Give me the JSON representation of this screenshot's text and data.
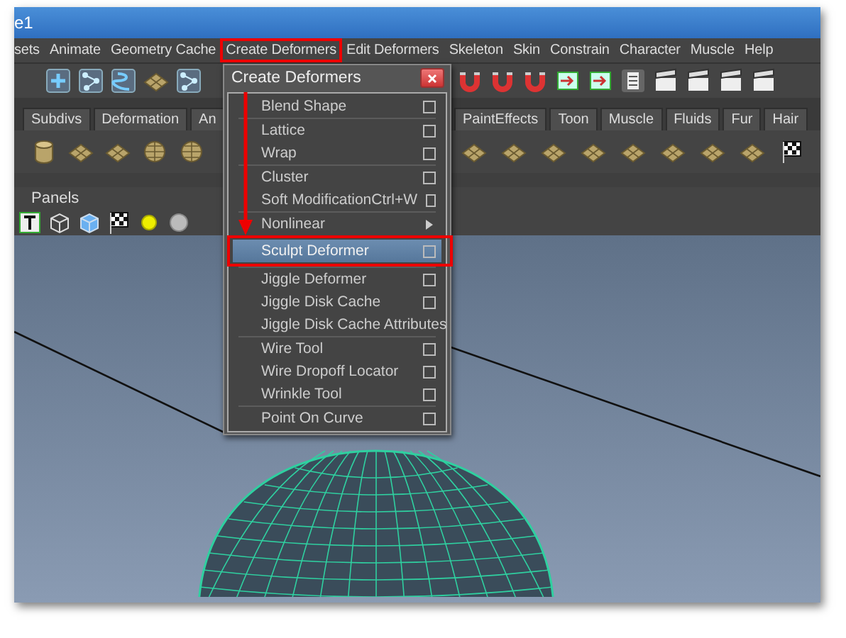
{
  "window": {
    "title": "e1"
  },
  "menu_bar": [
    "sets",
    "Animate",
    "Geometry Cache",
    "Create Deformers",
    "Edit Deformers",
    "Skeleton",
    "Skin",
    "Constrain",
    "Character",
    "Muscle",
    "Help"
  ],
  "shelf_tabs_left": [
    "Subdivs",
    "Deformation",
    "An"
  ],
  "shelf_tabs_right": [
    "PaintEffects",
    "Toon",
    "Muscle",
    "Fluids",
    "Fur",
    "Hair"
  ],
  "panel_menu": [
    "Panels"
  ],
  "popup": {
    "title": "Create Deformers",
    "groups": [
      [
        {
          "label": "Blend Shape",
          "option_box": true,
          "submenu": false,
          "selected": false
        }
      ],
      [
        {
          "label": "Lattice",
          "option_box": true,
          "submenu": false,
          "selected": false
        },
        {
          "label": "Wrap",
          "option_box": true,
          "submenu": false,
          "selected": false
        }
      ],
      [
        {
          "label": "Cluster",
          "option_box": true,
          "submenu": false,
          "selected": false
        },
        {
          "label": "Soft Modification",
          "shortcut": "Ctrl+W",
          "option_box": true,
          "submenu": false,
          "selected": false
        }
      ],
      [
        {
          "label": "Nonlinear",
          "option_box": false,
          "submenu": true,
          "selected": false
        },
        {
          "label": "Sculpt Deformer",
          "option_box": true,
          "submenu": false,
          "selected": true
        }
      ],
      [
        {
          "label": "Jiggle Deformer",
          "option_box": true,
          "submenu": false,
          "selected": false
        },
        {
          "label": "Jiggle Disk Cache",
          "option_box": true,
          "submenu": false,
          "selected": false
        },
        {
          "label": "Jiggle Disk Cache Attributes",
          "option_box": false,
          "submenu": false,
          "selected": false
        }
      ],
      [
        {
          "label": "Wire Tool",
          "option_box": true,
          "submenu": false,
          "selected": false
        },
        {
          "label": "Wire Dropoff Locator",
          "option_box": true,
          "submenu": false,
          "selected": false
        },
        {
          "label": "Wrinkle Tool",
          "option_box": true,
          "submenu": false,
          "selected": false
        }
      ],
      [
        {
          "label": "Point On Curve",
          "option_box": true,
          "submenu": false,
          "selected": false
        }
      ]
    ]
  }
}
